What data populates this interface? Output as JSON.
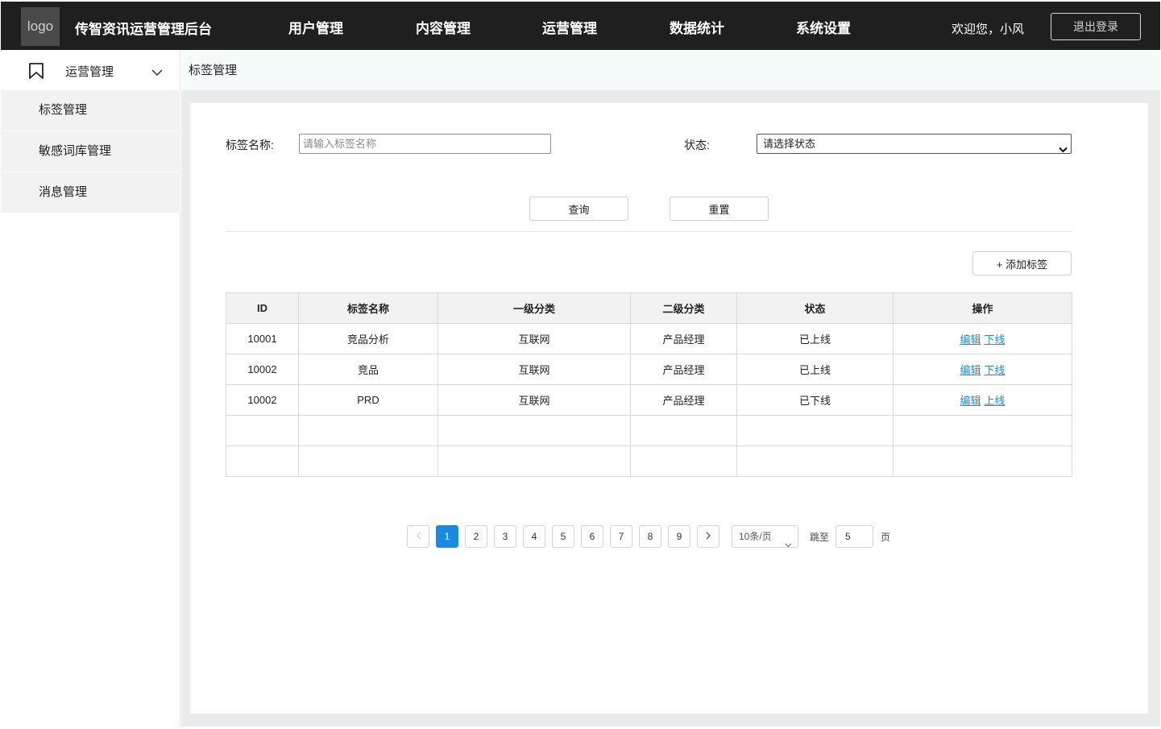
{
  "header": {
    "logo_text": "logo",
    "app_title": "传智资讯运营管理后台",
    "nav": [
      {
        "label": "用户管理"
      },
      {
        "label": "内容管理"
      },
      {
        "label": "运营管理"
      },
      {
        "label": "数据统计"
      },
      {
        "label": "系统设置"
      }
    ],
    "welcome": "欢迎您，小风",
    "logout_label": "退出登录"
  },
  "sidebar": {
    "group_label": "运营管理",
    "items": [
      {
        "label": "标签管理"
      },
      {
        "label": "敏感词库管理"
      },
      {
        "label": "消息管理"
      }
    ]
  },
  "breadcrumb": "标签管理",
  "filters": {
    "name_label": "标签名称:",
    "name_placeholder": "请输入标签名称",
    "status_label": "状态:",
    "status_selected": "请选择状态",
    "query_label": "查询",
    "reset_label": "重置"
  },
  "add_label": "+ 添加标签",
  "table": {
    "columns": [
      "ID",
      "标签名称",
      "一级分类",
      "二级分类",
      "状态",
      "操作"
    ],
    "rows": [
      {
        "id": "10001",
        "name": "竞品分析",
        "cat1": "互联网",
        "cat2": "产品经理",
        "status": "已上线",
        "op_edit": "编辑",
        "op_toggle": "下线"
      },
      {
        "id": "10002",
        "name": "竞品",
        "cat1": "互联网",
        "cat2": "产品经理",
        "status": "已上线",
        "op_edit": "编辑",
        "op_toggle": "下线"
      },
      {
        "id": "10002",
        "name": "PRD",
        "cat1": "互联网",
        "cat2": "产品经理",
        "status": "已下线",
        "op_edit": "编辑",
        "op_toggle": "上线"
      }
    ]
  },
  "pagination": {
    "pages": [
      "1",
      "2",
      "3",
      "4",
      "5",
      "6",
      "7",
      "8",
      "9"
    ],
    "current": "1",
    "page_size": "10条/页",
    "jump_label": "跳至",
    "jump_value": "5",
    "page_suffix": "页"
  },
  "colors": {
    "header_bg": "#1f1f1f",
    "accent": "#1a8ae0"
  }
}
